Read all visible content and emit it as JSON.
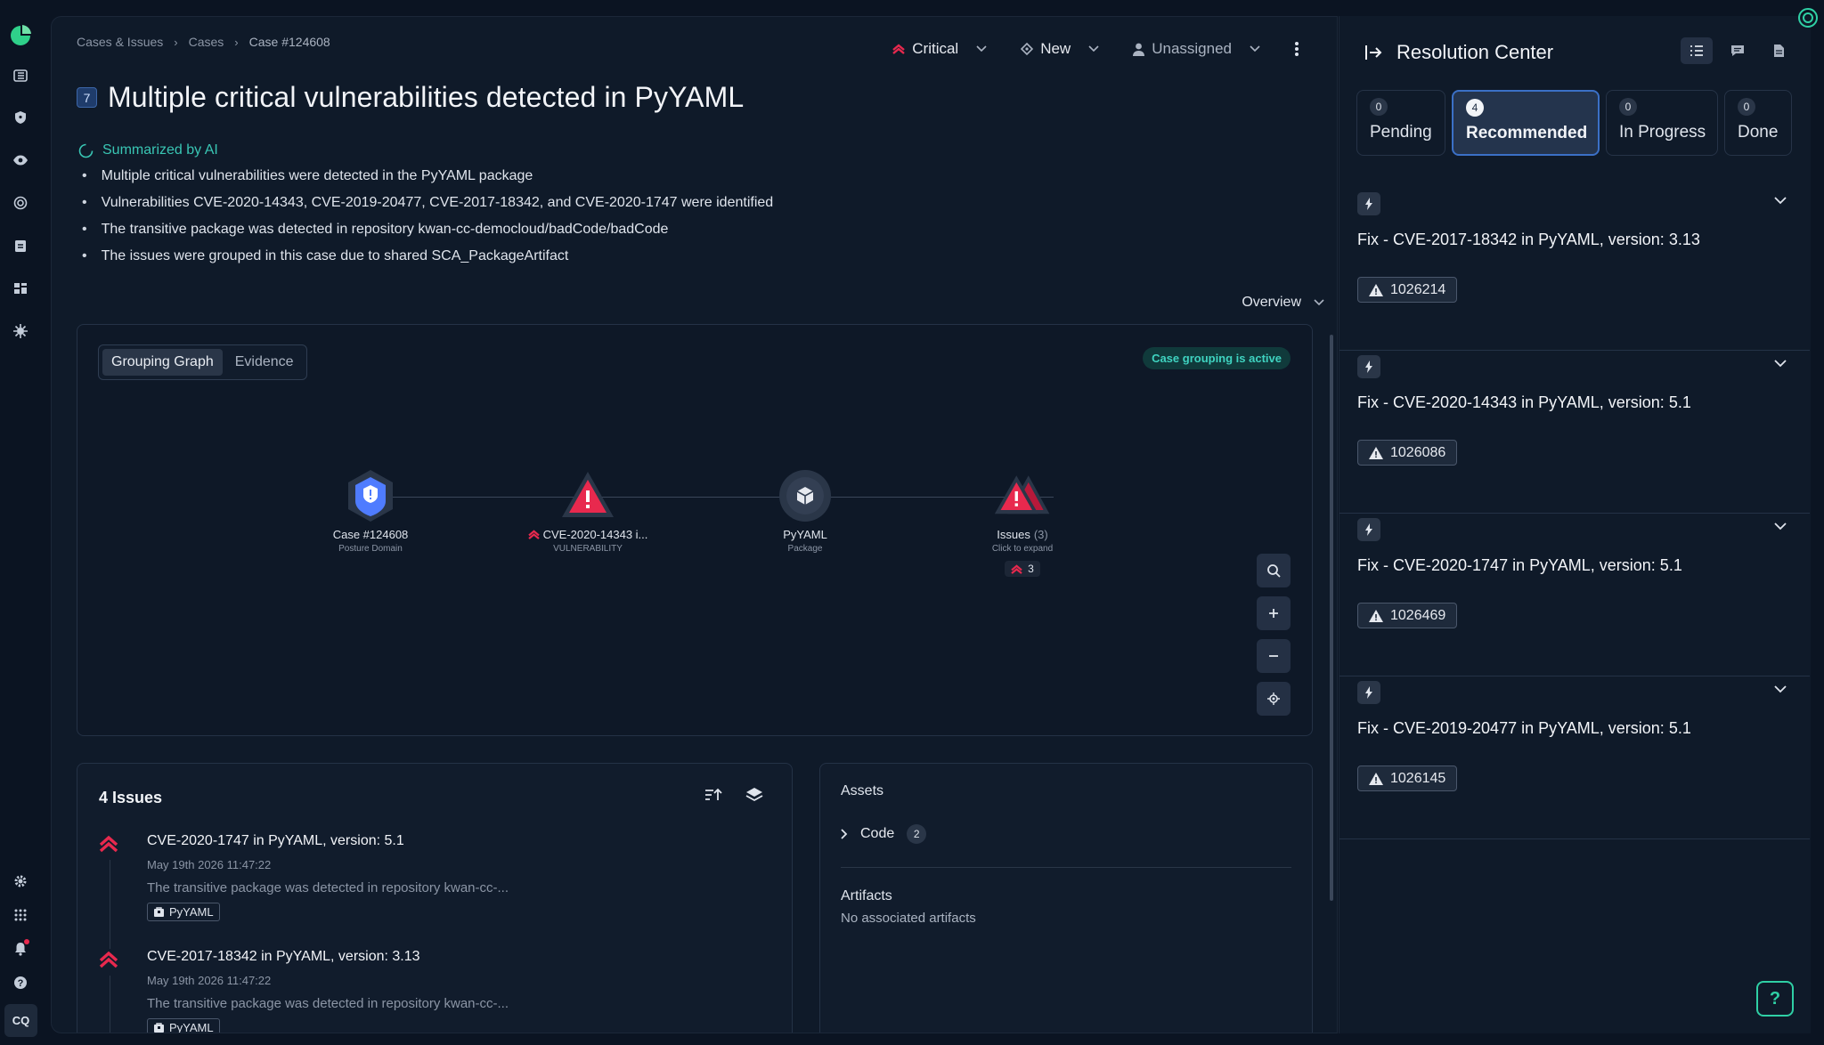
{
  "sidebar": {
    "icons": [
      "logo-icon",
      "list-icon",
      "shield-icon",
      "eye-icon",
      "target-icon",
      "clipboard-icon",
      "dashboard-icon",
      "bug-icon",
      "gear-icon",
      "apps-icon",
      "bell-icon",
      "help-icon"
    ],
    "user_initials": "CQ"
  },
  "breadcrumb": [
    "Cases & Issues",
    "Cases",
    "Case #124608"
  ],
  "header": {
    "severity": "Critical",
    "status": "New",
    "assignee": "Unassigned",
    "title_number": "7",
    "title": "Multiple critical vulnerabilities detected in PyYAML"
  },
  "summary": {
    "label": "Summarized by AI",
    "bullets": [
      "Multiple critical vulnerabilities were detected in the PyYAML package",
      "Vulnerabilities CVE-2020-14343, CVE-2019-20477, CVE-2017-18342, and CVE-2020-1747 were identified",
      "The transitive package was detected in repository kwan-cc-democloud/badCode/badCode",
      "The issues were grouped in this case due to shared SCA_PackageArtifact"
    ]
  },
  "overview_label": "Overview",
  "graph": {
    "tabs": [
      "Grouping Graph",
      "Evidence"
    ],
    "active_tab": "Grouping Graph",
    "badge": "Case grouping is active",
    "nodes": [
      {
        "label": "Case #124608",
        "sub": "Posture Domain"
      },
      {
        "label": "CVE-2020-14343 i...",
        "sub": "VULNERABILITY"
      },
      {
        "label": "PyYAML",
        "sub": "Package"
      },
      {
        "label": "Issues",
        "count_label": "(3)",
        "sub": "Click to expand",
        "count": "3"
      }
    ]
  },
  "issues": {
    "title": "4 Issues",
    "items": [
      {
        "title": "CVE-2020-1747 in PyYAML, version: 5.1",
        "date": "May 19th 2026 11:47:22",
        "desc": "The transitive package was detected in repository kwan-cc-...",
        "tag": "PyYAML"
      },
      {
        "title": "CVE-2017-18342 in PyYAML, version: 3.13",
        "date": "May 19th 2026 11:47:22",
        "desc": "The transitive package was detected in repository kwan-cc-...",
        "tag": "PyYAML"
      }
    ]
  },
  "assets": {
    "title": "Assets",
    "code_label": "Code",
    "code_count": "2",
    "artifacts_title": "Artifacts",
    "artifacts_note": "No associated artifacts"
  },
  "resolution": {
    "title": "Resolution Center",
    "tabs": [
      {
        "count": "0",
        "label": "Pending"
      },
      {
        "count": "4",
        "label": "Recommended"
      },
      {
        "count": "0",
        "label": "In Progress"
      },
      {
        "count": "0",
        "label": "Done"
      }
    ],
    "active_tab": "Recommended",
    "fixes": [
      {
        "title": "Fix - CVE-2017-18342 in PyYAML, version: 3.13",
        "tag": "1026214"
      },
      {
        "title": "Fix - CVE-2020-14343 in PyYAML, version: 5.1",
        "tag": "1026086"
      },
      {
        "title": "Fix - CVE-2020-1747 in PyYAML, version: 5.1",
        "tag": "1026469"
      },
      {
        "title": "Fix - CVE-2019-20477 in PyYAML, version: 5.1",
        "tag": "1026145"
      }
    ]
  },
  "help_label": "?",
  "colors": {
    "accent": "#3b70c6",
    "critical": "#e8294e",
    "teal": "#39c6b4",
    "background": "#0b1422",
    "panel": "#0f1a29"
  }
}
